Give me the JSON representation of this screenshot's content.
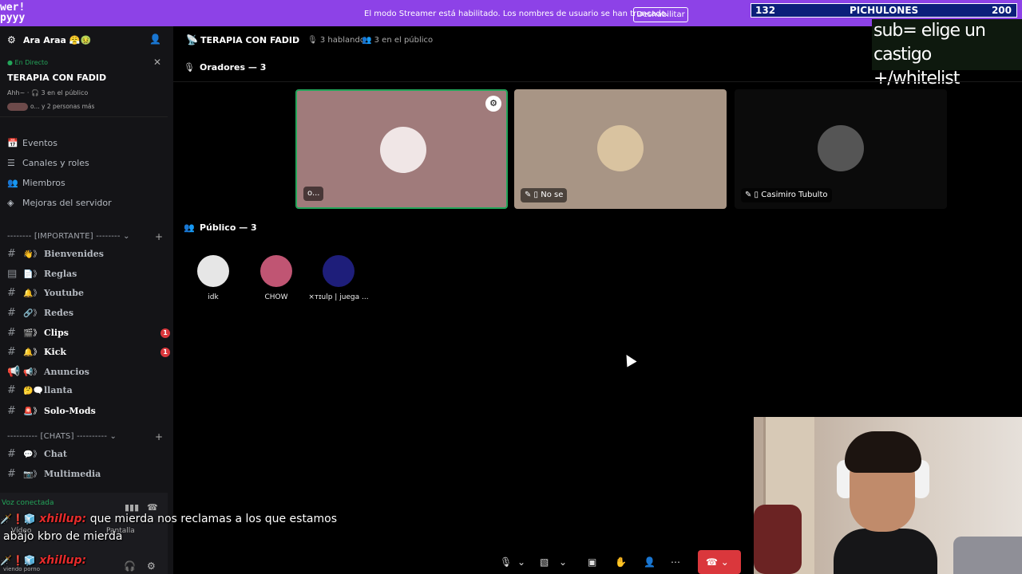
{
  "banner": {
    "logo_text": "wer!\npyyy",
    "message": "El modo Streamer está habilitado. Los nombres de usuario se han truncado.",
    "disable_label": "Deshabilitar"
  },
  "counter": {
    "left": "132",
    "label": "PICHULONES",
    "right": "200"
  },
  "overlay_text": {
    "line1": "sub= elige un castigo",
    "line2": "+/whitelist"
  },
  "server": {
    "name": "Ara Araa",
    "emojis": "😤🤢"
  },
  "live": {
    "status": "En Directo",
    "title": "TERAPIA CON FADID",
    "sub1": "Ahh~ · 🎧 3 en el público",
    "sub2": "o... y 2 personas más"
  },
  "menu": [
    {
      "icon": "📅",
      "label": "Eventos"
    },
    {
      "icon": "☰",
      "label": "Canales y roles"
    },
    {
      "icon": "👥",
      "label": "Miembros"
    },
    {
      "icon": "◈",
      "label": "Mejoras del servidor"
    }
  ],
  "categories": {
    "importante": "-------- [IMPORTANTE] --------",
    "chats": "---------- [CHATS] ----------"
  },
  "channels": [
    {
      "emoji": "👋》",
      "name": "Bienvenides",
      "badge": ""
    },
    {
      "emoji": "📄》",
      "name": "Reglas",
      "badge": ""
    },
    {
      "emoji": "🔔》",
      "name": "Youtube",
      "badge": ""
    },
    {
      "emoji": "🔗》",
      "name": "Redes",
      "badge": ""
    },
    {
      "emoji": "🎬》",
      "name": "Clips",
      "badge": "1"
    },
    {
      "emoji": "🔔》",
      "name": "Kick",
      "badge": "1"
    },
    {
      "emoji": "📢》",
      "name": "Anuncios",
      "badge": ""
    },
    {
      "emoji": "🤔🗨️",
      "name": "llanta",
      "badge": ""
    },
    {
      "emoji": "🚨》",
      "name": "Solo-Mods",
      "badge": ""
    },
    {
      "emoji": "💬》",
      "name": "Chat",
      "badge": ""
    },
    {
      "emoji": "📷》",
      "name": "Multimedia",
      "badge": ""
    }
  ],
  "voice": {
    "status": "Voz conectada",
    "video": "Vídeo",
    "screen": "Pantalla",
    "streaming": "viendo porno"
  },
  "chat": [
    {
      "user": "xhillup:",
      "text": "que mierda nos reclamas a los que estamos"
    },
    {
      "user": "",
      "text": "abajo kbro de mierda"
    },
    {
      "user": "xhillup:",
      "text": ""
    }
  ],
  "stage": {
    "title": "TERAPIA CON FADID",
    "speaking": "3 hablando",
    "audience": "3 en el público",
    "speakers_header": "Oradores — 3",
    "audience_header": "Público — 3"
  },
  "speakers": [
    {
      "label": "o...",
      "bg": "#a07b7b",
      "avatar": "#f0e6e6"
    },
    {
      "label": "No se",
      "bg": "#a89585",
      "avatar": "#d9c3a0"
    },
    {
      "label": "Casimiro Tubulto",
      "bg": "#0b0b0b",
      "avatar": "#555555"
    }
  ],
  "audience": [
    {
      "name": "idk",
      "color": "#e6e6e6"
    },
    {
      "name": "CHOW",
      "color": "#c05573"
    },
    {
      "name": "×ᴛɪulp | juega ...",
      "color": "#1e1e7a"
    }
  ],
  "colors": {
    "banner": "#8d42e7",
    "live": "#23a55a",
    "badge": "#da373c",
    "hangup": "#da373c"
  }
}
